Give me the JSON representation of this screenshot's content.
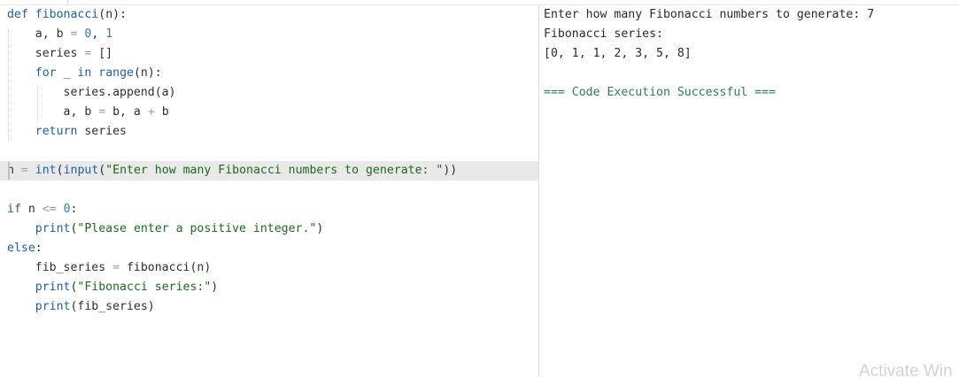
{
  "editor": {
    "lines": [
      [
        {
          "t": "def",
          "c": "kw"
        },
        {
          "t": " "
        },
        {
          "t": "fibonacci",
          "c": "fn"
        },
        {
          "t": "(n):"
        }
      ],
      [
        {
          "t": "    a, b "
        },
        {
          "t": "=",
          "c": "op"
        },
        {
          "t": " "
        },
        {
          "t": "0",
          "c": "num"
        },
        {
          "t": ", "
        },
        {
          "t": "1",
          "c": "num"
        }
      ],
      [
        {
          "t": "    series "
        },
        {
          "t": "=",
          "c": "op"
        },
        {
          "t": " []"
        }
      ],
      [
        {
          "t": "    "
        },
        {
          "t": "for",
          "c": "kw"
        },
        {
          "t": " _ "
        },
        {
          "t": "in",
          "c": "kw"
        },
        {
          "t": " "
        },
        {
          "t": "range",
          "c": "fn"
        },
        {
          "t": "(n):"
        }
      ],
      [
        {
          "t": "        series.append(a)"
        }
      ],
      [
        {
          "t": "        a, b "
        },
        {
          "t": "=",
          "c": "op"
        },
        {
          "t": " b, a "
        },
        {
          "t": "+",
          "c": "op"
        },
        {
          "t": " b"
        }
      ],
      [
        {
          "t": "    "
        },
        {
          "t": "return",
          "c": "kw"
        },
        {
          "t": " series"
        }
      ],
      [],
      [
        {
          "t": "n "
        },
        {
          "t": "=",
          "c": "op"
        },
        {
          "t": " "
        },
        {
          "t": "int",
          "c": "fn"
        },
        {
          "t": "("
        },
        {
          "t": "input",
          "c": "fn"
        },
        {
          "t": "("
        },
        {
          "t": "\"Enter how many Fibonacci numbers to generate: \"",
          "c": "str"
        },
        {
          "t": "))"
        }
      ],
      [],
      [
        {
          "t": "if",
          "c": "kw"
        },
        {
          "t": " n "
        },
        {
          "t": "<=",
          "c": "op"
        },
        {
          "t": " "
        },
        {
          "t": "0",
          "c": "num"
        },
        {
          "t": ":"
        }
      ],
      [
        {
          "t": "    "
        },
        {
          "t": "print",
          "c": "fn"
        },
        {
          "t": "("
        },
        {
          "t": "\"Please enter a positive integer.\"",
          "c": "str"
        },
        {
          "t": ")"
        }
      ],
      [
        {
          "t": "else",
          "c": "kw"
        },
        {
          "t": ":"
        }
      ],
      [
        {
          "t": "    fib_series "
        },
        {
          "t": "=",
          "c": "op"
        },
        {
          "t": " fibonacci(n)"
        }
      ],
      [
        {
          "t": "    "
        },
        {
          "t": "print",
          "c": "fn"
        },
        {
          "t": "("
        },
        {
          "t": "\"Fibonacci series:\"",
          "c": "str"
        },
        {
          "t": ")"
        }
      ],
      [
        {
          "t": "    "
        },
        {
          "t": "print",
          "c": "fn"
        },
        {
          "t": "(fib_series)"
        }
      ]
    ],
    "active_line": 8
  },
  "output": {
    "lines": [
      "Enter how many Fibonacci numbers to generate: 7",
      "Fibonacci series:",
      "[0, 1, 1, 2, 3, 5, 8]",
      "",
      "=== Code Execution Successful ==="
    ]
  },
  "watermark": "Activate Win"
}
